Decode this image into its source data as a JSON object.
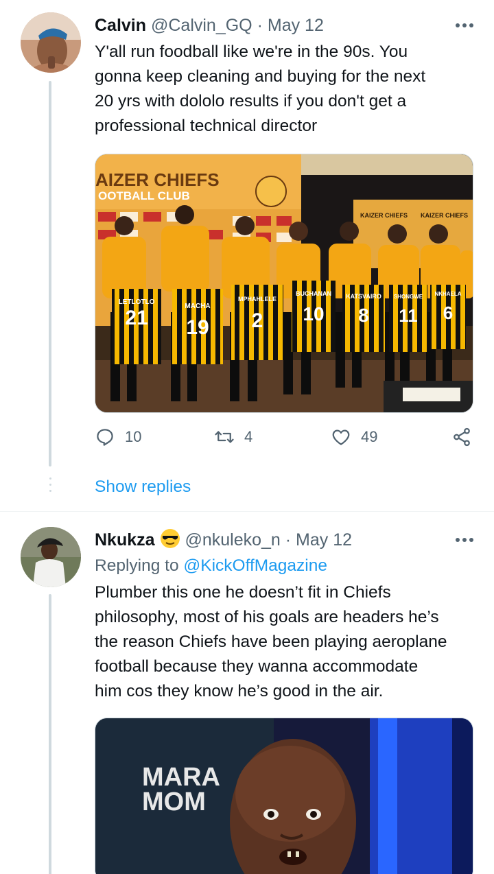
{
  "tweet1": {
    "name": "Calvin",
    "handle": "@Calvin_GQ",
    "separator": "·",
    "date": "May 12",
    "lines": [
      "Y'all run foodball like we're in the 90s. You",
      "gonna keep cleaning and buying for the next",
      "20 yrs with dololo results if you don't get a",
      "professional technical director"
    ],
    "image": {
      "banner_line1": "AIZER CHIEFS",
      "banner_line2": "OOTBALL CLUB",
      "crest_text": "KAIZER CHIEFS",
      "board_text_left": "KAIZER CHIEFS",
      "board_text_right": "KAIZER CHIEFS",
      "jerseys": [
        {
          "name": "LETLOTLO",
          "number": "21"
        },
        {
          "name": "MACHA",
          "number": "19"
        },
        {
          "name": "MPHAHLELE",
          "number": "2"
        },
        {
          "name": "BUCHANAN",
          "number": "10"
        },
        {
          "name": "KATSVAIRO",
          "number": "8"
        },
        {
          "name": "SHONGWE",
          "number": "11"
        },
        {
          "name": "NKHAELA",
          "number": "6"
        }
      ]
    },
    "actions": {
      "replies": "10",
      "retweets": "4",
      "likes": "49"
    },
    "show_replies": "Show replies"
  },
  "tweet2": {
    "name": "Nkukza",
    "name_emoji": "sunglasses-emoji",
    "handle": "@nkuleko_n",
    "separator": "·",
    "date": "May 12",
    "replying_prefix": "Replying to",
    "replying_to": "@KickOffMagazine",
    "lines": [
      "Plumber this one he doesn’t fit in Chiefs",
      "philosophy, most of his goals are headers he’s",
      "the reason Chiefs have been playing aeroplane",
      "football because they wanna accommodate",
      "him cos they know he’s good in the air."
    ],
    "image": {
      "overlay_line1": "MARA",
      "overlay_line2": "MOM"
    }
  },
  "icons": {
    "reply": "reply-icon",
    "retweet": "retweet-icon",
    "like": "heart-icon",
    "share": "share-icon",
    "more": "more-icon"
  },
  "colors": {
    "accent": "#1d9bf0",
    "text": "#0f1419",
    "muted": "#536471",
    "line": "#cfd9de",
    "chiefs_gold": "#f6a800"
  }
}
